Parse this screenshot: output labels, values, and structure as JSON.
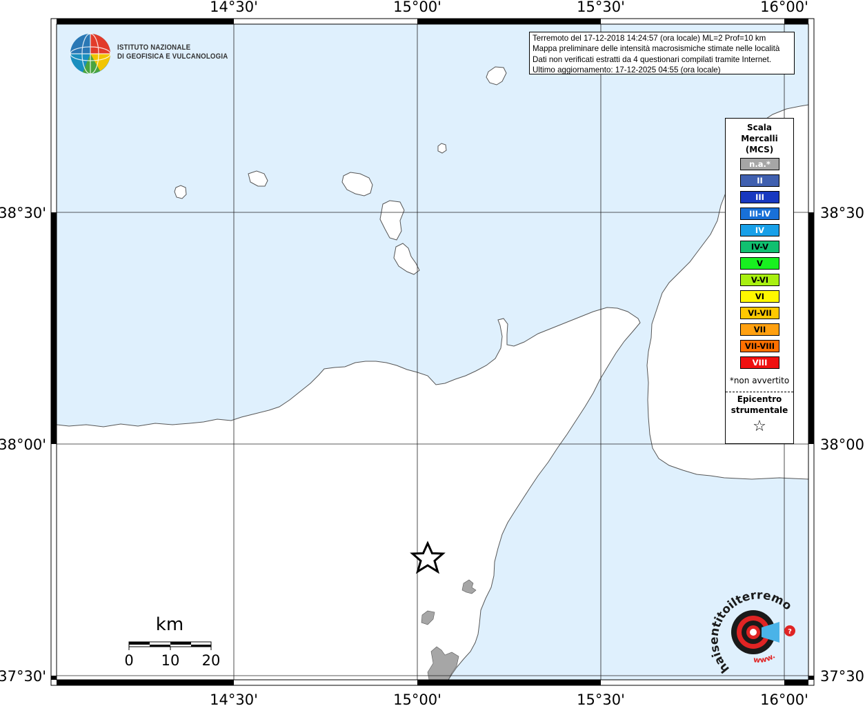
{
  "map": {
    "lon_labels": [
      "14°30'",
      "15°00'",
      "15°30'",
      "16°00'"
    ],
    "lat_labels": [
      "38°30'",
      "38°00'",
      "37°30'"
    ],
    "sea_color": "#dff0fd",
    "land_color": "#ffffff",
    "affected_color": "#a6a6a6"
  },
  "logo": {
    "line1": "ISTITUTO NAZIONALE",
    "line2": "DI GEOFISICA E VULCANOLOGIA"
  },
  "info": {
    "line1": "Terremoto del 17-12-2018 14:24:57 (ora locale) ML=2 Prof=10 km",
    "line2": "Mappa preliminare delle intensità macrosismiche stimate nelle località",
    "line3": "Dati non verificati estratti da 4 questionari compilati tramite Internet.",
    "line4": "Ultimo aggiornamento: 17-12-2025 04:55 (ora locale)"
  },
  "legend": {
    "title1": "Scala",
    "title2": "Mercalli",
    "title3": "(MCS)",
    "items": [
      {
        "label": "n.a.*",
        "color": "#a6a6a6",
        "text": "#ffffff"
      },
      {
        "label": "II",
        "color": "#4060b0",
        "text": "#ffffff"
      },
      {
        "label": "III",
        "color": "#1838c0",
        "text": "#ffffff"
      },
      {
        "label": "III-IV",
        "color": "#1870d8",
        "text": "#ffffff"
      },
      {
        "label": "IV",
        "color": "#18a0e8",
        "text": "#ffffff"
      },
      {
        "label": "IV-V",
        "color": "#10c070",
        "text": "#000000"
      },
      {
        "label": "V",
        "color": "#18f020",
        "text": "#000000"
      },
      {
        "label": "V-VI",
        "color": "#a8f010",
        "text": "#000000"
      },
      {
        "label": "VI",
        "color": "#fff800",
        "text": "#000000"
      },
      {
        "label": "VI-VII",
        "color": "#ffc800",
        "text": "#000000"
      },
      {
        "label": "VII",
        "color": "#ffa010",
        "text": "#000000"
      },
      {
        "label": "VII-VIII",
        "color": "#ff7000",
        "text": "#000000"
      },
      {
        "label": "VIII",
        "color": "#f01010",
        "text": "#ffffff"
      }
    ],
    "footnote": "*non avvertito",
    "epicenter1": "Epicentro",
    "epicenter2": "strumentale",
    "star": "☆"
  },
  "scalebar": {
    "unit": "km",
    "ticks": [
      "0",
      "10",
      "20"
    ]
  },
  "brand": {
    "name": "haisentitoilterremoto.it",
    "url": "www."
  }
}
